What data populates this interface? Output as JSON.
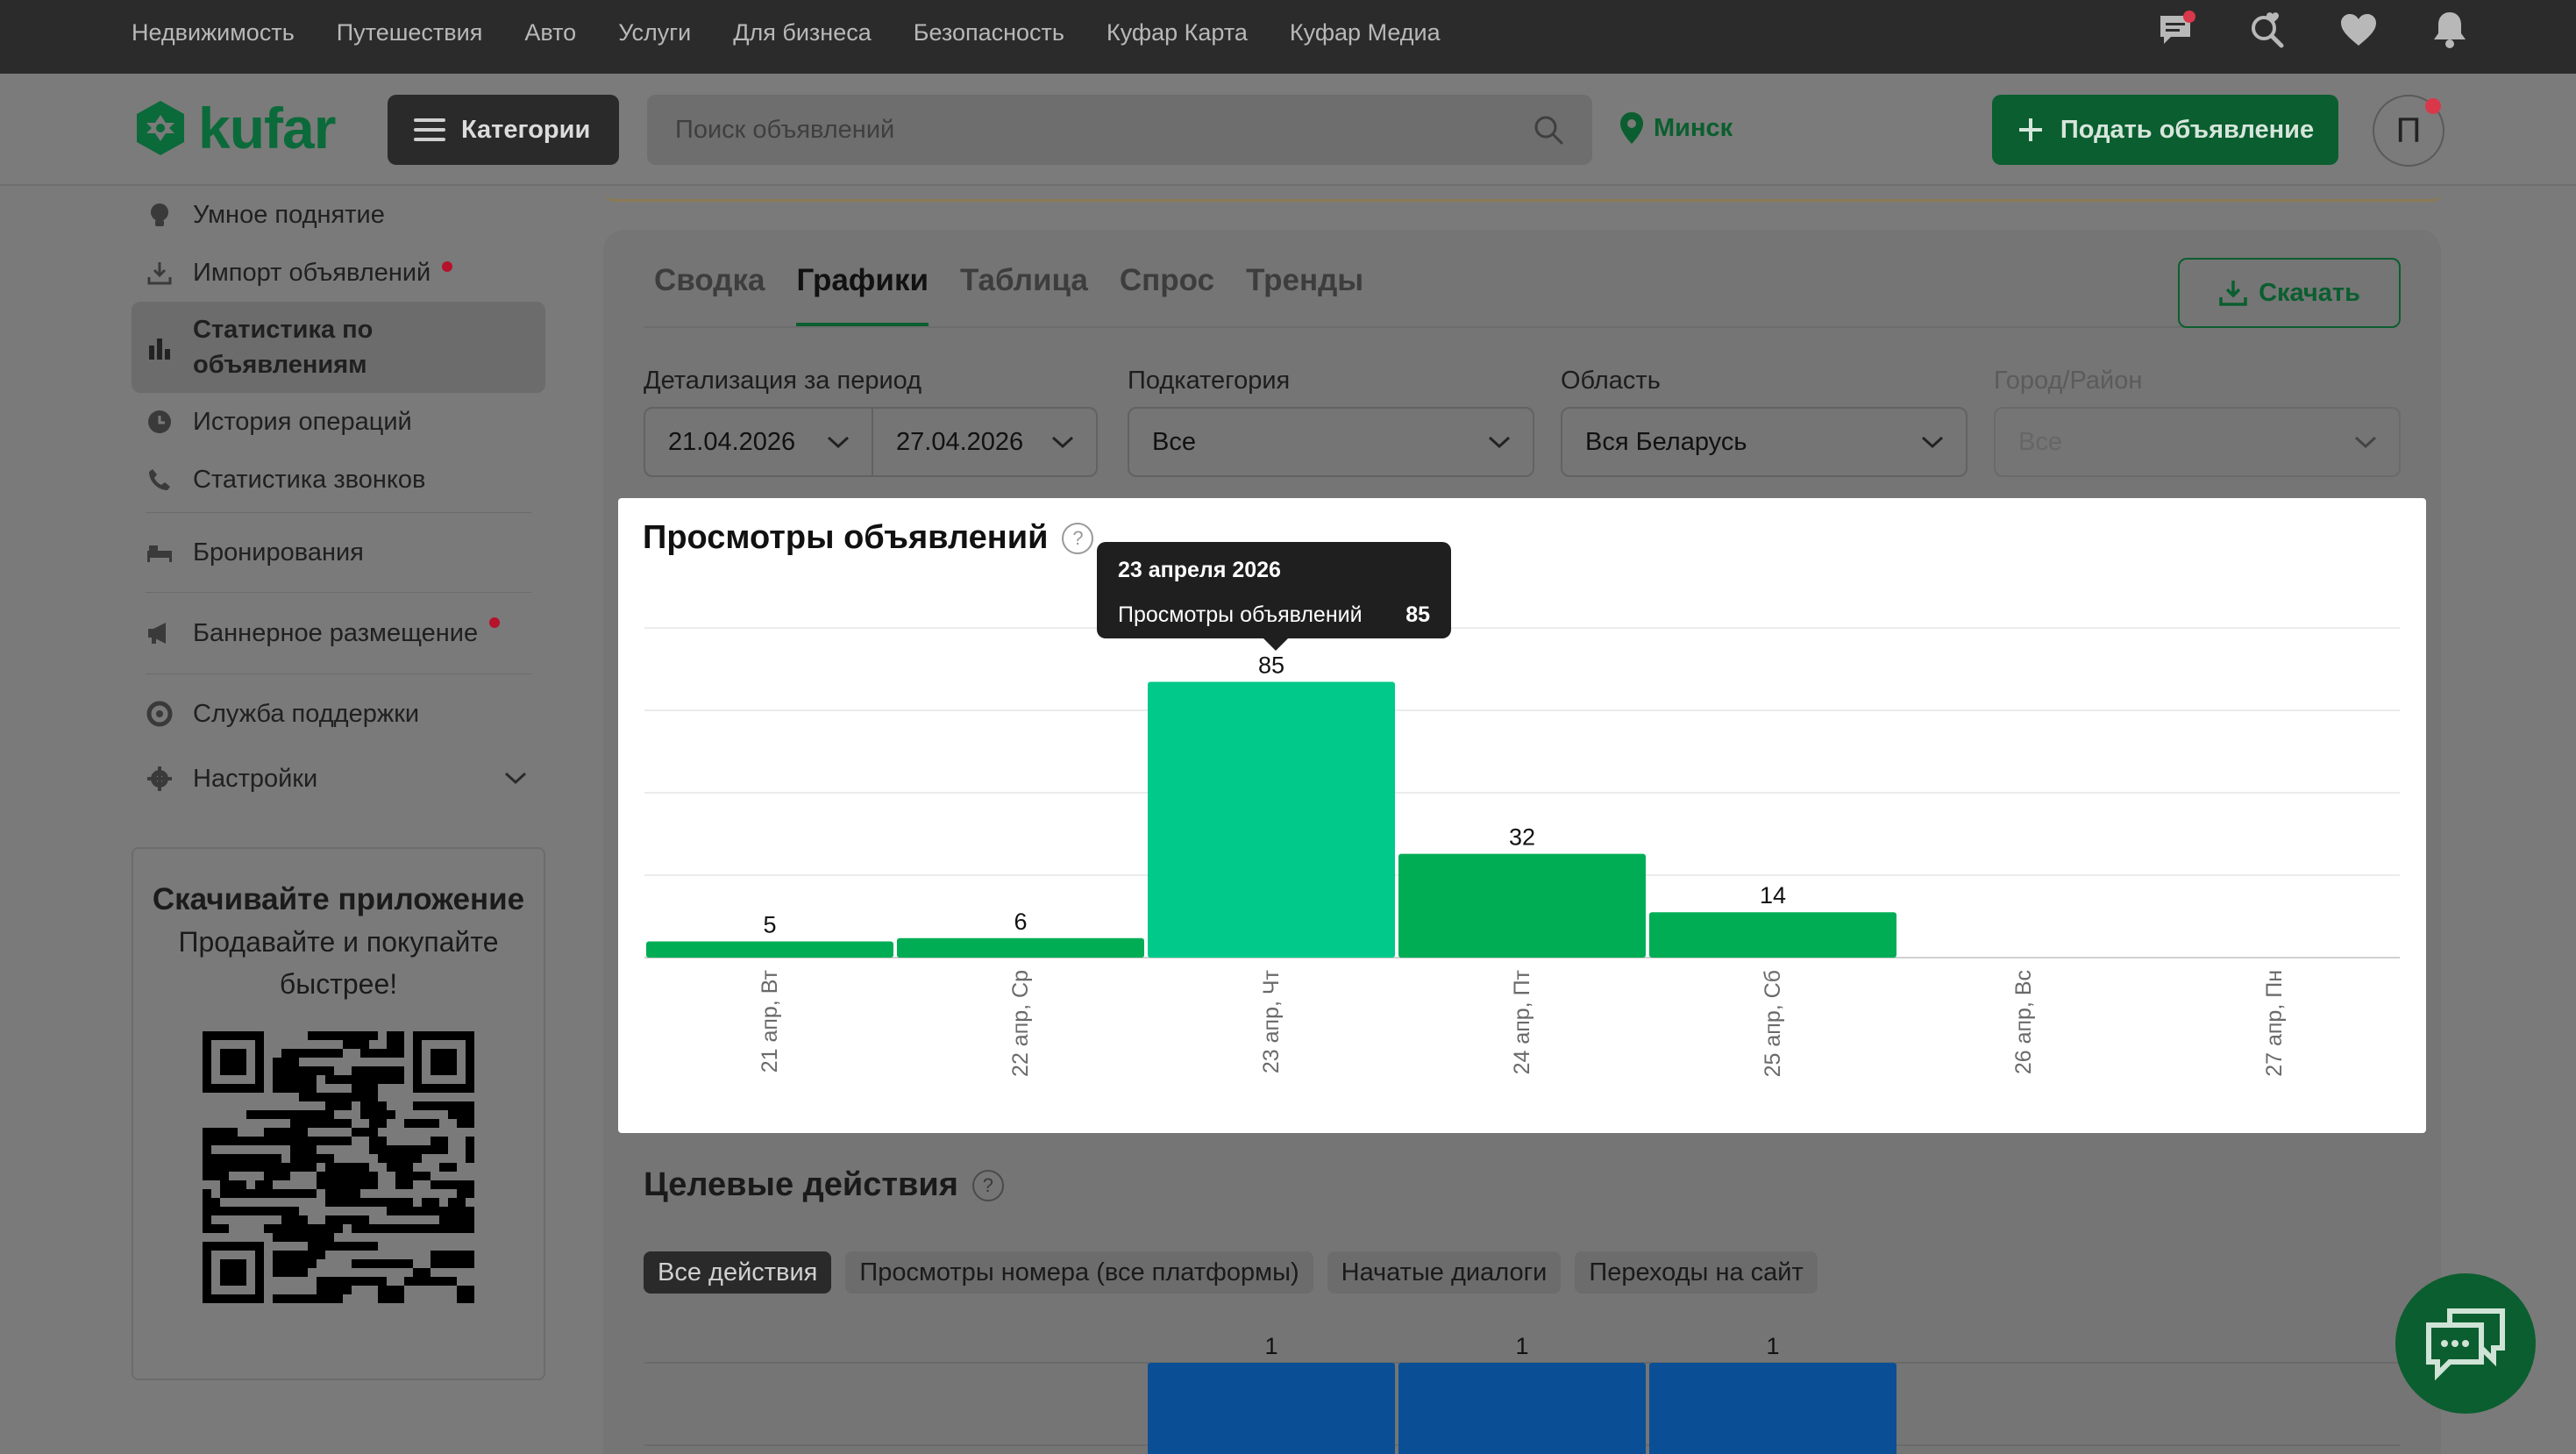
{
  "topnav": {
    "links": [
      "Недвижимость",
      "Путешествия",
      "Авто",
      "Услуги",
      "Для бизнеса",
      "Безопасность",
      "Куфар Карта",
      "Куфар Медиа"
    ]
  },
  "header": {
    "logo_text": "kufar",
    "categories_label": "Категории",
    "search_placeholder": "Поиск объявлений",
    "city": "Минск",
    "post_button": "Подать объявление",
    "avatar_letter": "П"
  },
  "sidebar": {
    "items": [
      {
        "label": "Умное поднятие",
        "icon": "lightbulb-icon"
      },
      {
        "label": "Импорт объявлений",
        "icon": "download-icon"
      },
      {
        "label": "Статистика по объявлениям",
        "icon": "bar-chart-icon"
      },
      {
        "label": "История операций",
        "icon": "clock-icon"
      },
      {
        "label": "Статистика звонков",
        "icon": "phone-icon"
      },
      {
        "label": "Бронирования",
        "icon": "bed-icon"
      },
      {
        "label": "Баннерное размещение",
        "icon": "megaphone-icon"
      },
      {
        "label": "Служба поддержки",
        "icon": "lifebuoy-icon"
      },
      {
        "label": "Настройки",
        "icon": "gear-icon"
      }
    ],
    "app_title": "Скачивайте приложение",
    "app_subtitle": "Продавайте и покупайте быстрее!"
  },
  "tabs": [
    "Сводка",
    "Графики",
    "Таблица",
    "Спрос",
    "Тренды"
  ],
  "download_label": "Скачать",
  "filters": {
    "period_label": "Детализация за период",
    "date_from": "21.04.2026",
    "date_to": "27.04.2026",
    "subcategory_label": "Подкатегория",
    "subcategory_value": "Все",
    "region_label": "Область",
    "region_value": "Вся Беларусь",
    "city_label": "Город/Район",
    "city_value": "Все"
  },
  "views_chart": {
    "title": "Просмотры объявлений",
    "tooltip": {
      "date": "23 апреля 2026",
      "label": "Просмотры объявлений",
      "value": "85"
    }
  },
  "targets": {
    "title": "Целевые действия",
    "chips": [
      "Все действия",
      "Просмотры номера (все платформы)",
      "Начатые диалоги",
      "Переходы на сайт"
    ]
  },
  "colors": {
    "bar": "#00c98a",
    "bar_dim": "#00ad55",
    "bar_blue": "#0a4f95",
    "brand": "#0b5e2f"
  },
  "chart_data": [
    {
      "type": "bar",
      "title": "Просмотры объявлений",
      "categories": [
        "21 апр, Вт",
        "22 апр, Ср",
        "23 апр, Чт",
        "24 апр, Пт",
        "25 апр, Сб",
        "26 апр, Вс",
        "27 апр, Пн"
      ],
      "values": [
        5,
        6,
        85,
        32,
        14,
        0,
        0
      ],
      "ylim": [
        0,
        100
      ],
      "grid": true
    },
    {
      "type": "bar",
      "title": "Целевые действия",
      "categories": [
        "21 апр, Вт",
        "22 апр, Ср",
        "23 апр, Чт",
        "24 апр, Пт",
        "25 апр, Сб",
        "26 апр, Вс",
        "27 апр, Пн"
      ],
      "values": [
        0,
        0,
        1,
        1,
        1,
        0,
        0
      ]
    }
  ]
}
